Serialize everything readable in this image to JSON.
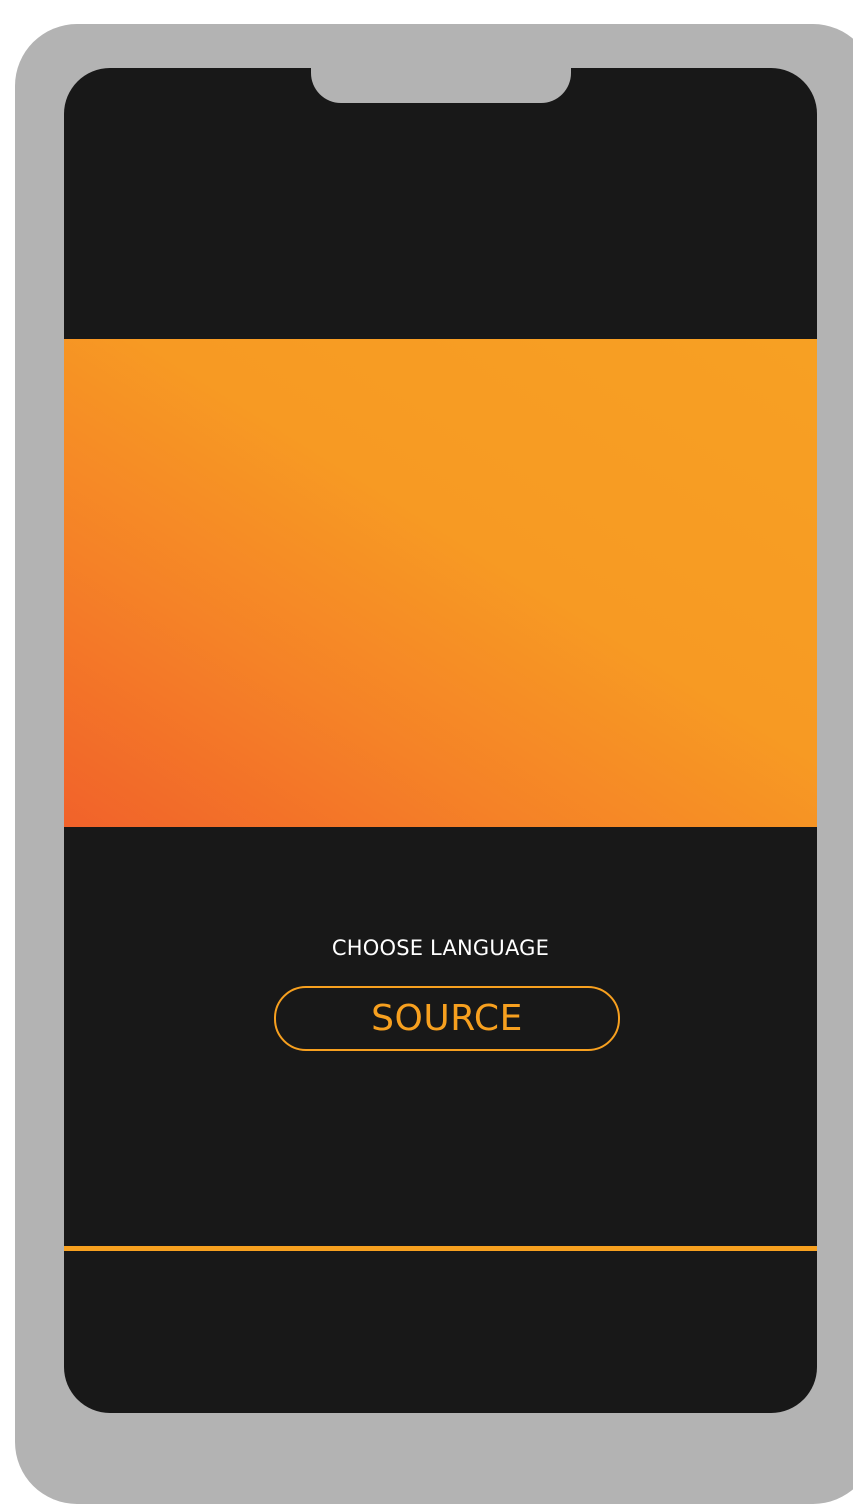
{
  "screen": {
    "choose_label": "CHOOSE LANGUAGE",
    "source_button_label": "SOURCE"
  },
  "colors": {
    "accent": "#f7a01f",
    "gradient_start": "#f1622a",
    "gradient_end": "#f7a023",
    "screen_background": "#181818",
    "device_frame": "#b3b3b3"
  }
}
